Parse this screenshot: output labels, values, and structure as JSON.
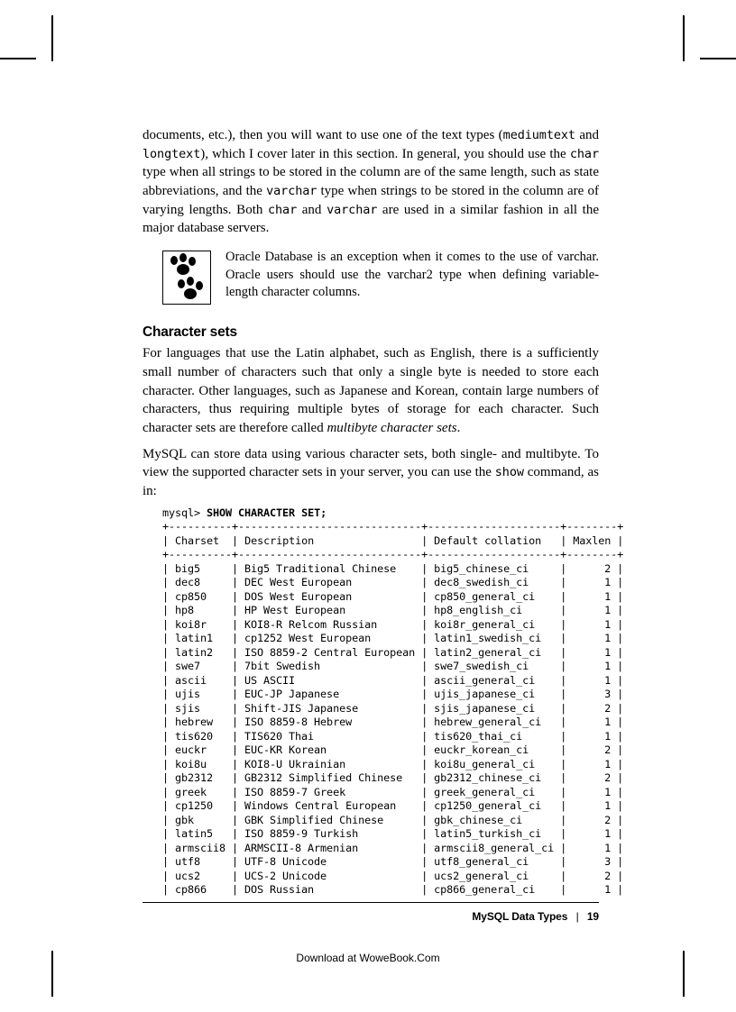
{
  "para1_a": "documents, etc.), then you will want to use one of the text types (",
  "para1_b": "mediumtext",
  "para1_c": " and ",
  "para1_d": "longtext",
  "para1_e": "), which I cover later in this section. In general, you should use the ",
  "para1_f": "char",
  "para1_g": " type when all strings to be stored in the column are of the same length, such as state abbreviations, and the ",
  "para1_h": "varchar",
  "para1_i": " type when strings to be stored in the column are of varying lengths. Both ",
  "para1_j": "char",
  "para1_k": " and ",
  "para1_l": "varchar",
  "para1_m": " are used in a similar fashion in all the major database servers.",
  "note_a": "Oracle Database is an exception when it comes to the use of ",
  "note_b": "varchar",
  "note_c": ". Oracle users should use the ",
  "note_d": "varchar2",
  "note_e": " type when defining variable-length character columns.",
  "h3": "Character sets",
  "para2_a": "For languages that use the Latin alphabet, such as English, there is a sufficiently small number of characters such that only a single byte is needed to store each character. Other languages, such as Japanese and Korean, contain large numbers of characters, thus requiring multiple bytes of storage for each character. Such character sets are therefore called ",
  "para2_b": "multibyte character sets",
  "para2_c": ".",
  "para3_a": "MySQL can store data using various character sets, both single- and multibyte. To view the supported character sets in your server, you can use the ",
  "para3_b": "show",
  "para3_c": " command, as in:",
  "prompt_a": "mysql> ",
  "prompt_b": "SHOW CHARACTER SET;",
  "hdr_charset": "Charset",
  "hdr_desc": "Description",
  "hdr_coll": "Default collation",
  "hdr_max": "Maxlen",
  "chart_data": {
    "type": "table",
    "title": "SHOW CHARACTER SET",
    "columns": [
      "Charset",
      "Description",
      "Default collation",
      "Maxlen"
    ],
    "rows": [
      {
        "charset": "big5",
        "desc": "Big5 Traditional Chinese",
        "coll": "big5_chinese_ci",
        "max": 2
      },
      {
        "charset": "dec8",
        "desc": "DEC West European",
        "coll": "dec8_swedish_ci",
        "max": 1
      },
      {
        "charset": "cp850",
        "desc": "DOS West European",
        "coll": "cp850_general_ci",
        "max": 1
      },
      {
        "charset": "hp8",
        "desc": "HP West European",
        "coll": "hp8_english_ci",
        "max": 1
      },
      {
        "charset": "koi8r",
        "desc": "KOI8-R Relcom Russian",
        "coll": "koi8r_general_ci",
        "max": 1
      },
      {
        "charset": "latin1",
        "desc": "cp1252 West European",
        "coll": "latin1_swedish_ci",
        "max": 1
      },
      {
        "charset": "latin2",
        "desc": "ISO 8859-2 Central European",
        "coll": "latin2_general_ci",
        "max": 1
      },
      {
        "charset": "swe7",
        "desc": "7bit Swedish",
        "coll": "swe7_swedish_ci",
        "max": 1
      },
      {
        "charset": "ascii",
        "desc": "US ASCII",
        "coll": "ascii_general_ci",
        "max": 1
      },
      {
        "charset": "ujis",
        "desc": "EUC-JP Japanese",
        "coll": "ujis_japanese_ci",
        "max": 3
      },
      {
        "charset": "sjis",
        "desc": "Shift-JIS Japanese",
        "coll": "sjis_japanese_ci",
        "max": 2
      },
      {
        "charset": "hebrew",
        "desc": "ISO 8859-8 Hebrew",
        "coll": "hebrew_general_ci",
        "max": 1
      },
      {
        "charset": "tis620",
        "desc": "TIS620 Thai",
        "coll": "tis620_thai_ci",
        "max": 1
      },
      {
        "charset": "euckr",
        "desc": "EUC-KR Korean",
        "coll": "euckr_korean_ci",
        "max": 2
      },
      {
        "charset": "koi8u",
        "desc": "KOI8-U Ukrainian",
        "coll": "koi8u_general_ci",
        "max": 1
      },
      {
        "charset": "gb2312",
        "desc": "GB2312 Simplified Chinese",
        "coll": "gb2312_chinese_ci",
        "max": 2
      },
      {
        "charset": "greek",
        "desc": "ISO 8859-7 Greek",
        "coll": "greek_general_ci",
        "max": 1
      },
      {
        "charset": "cp1250",
        "desc": "Windows Central European",
        "coll": "cp1250_general_ci",
        "max": 1
      },
      {
        "charset": "gbk",
        "desc": "GBK Simplified Chinese",
        "coll": "gbk_chinese_ci",
        "max": 2
      },
      {
        "charset": "latin5",
        "desc": "ISO 8859-9 Turkish",
        "coll": "latin5_turkish_ci",
        "max": 1
      },
      {
        "charset": "armscii8",
        "desc": "ARMSCII-8 Armenian",
        "coll": "armscii8_general_ci",
        "max": 1
      },
      {
        "charset": "utf8",
        "desc": "UTF-8 Unicode",
        "coll": "utf8_general_ci",
        "max": 3
      },
      {
        "charset": "ucs2",
        "desc": "UCS-2 Unicode",
        "coll": "ucs2_general_ci",
        "max": 2
      },
      {
        "charset": "cp866",
        "desc": "DOS Russian",
        "coll": "cp866_general_ci",
        "max": 1
      }
    ]
  },
  "footer_section": "MySQL Data Types",
  "footer_sep": "|",
  "footer_page": "19",
  "download_note": "Download at WoweBook.Com"
}
